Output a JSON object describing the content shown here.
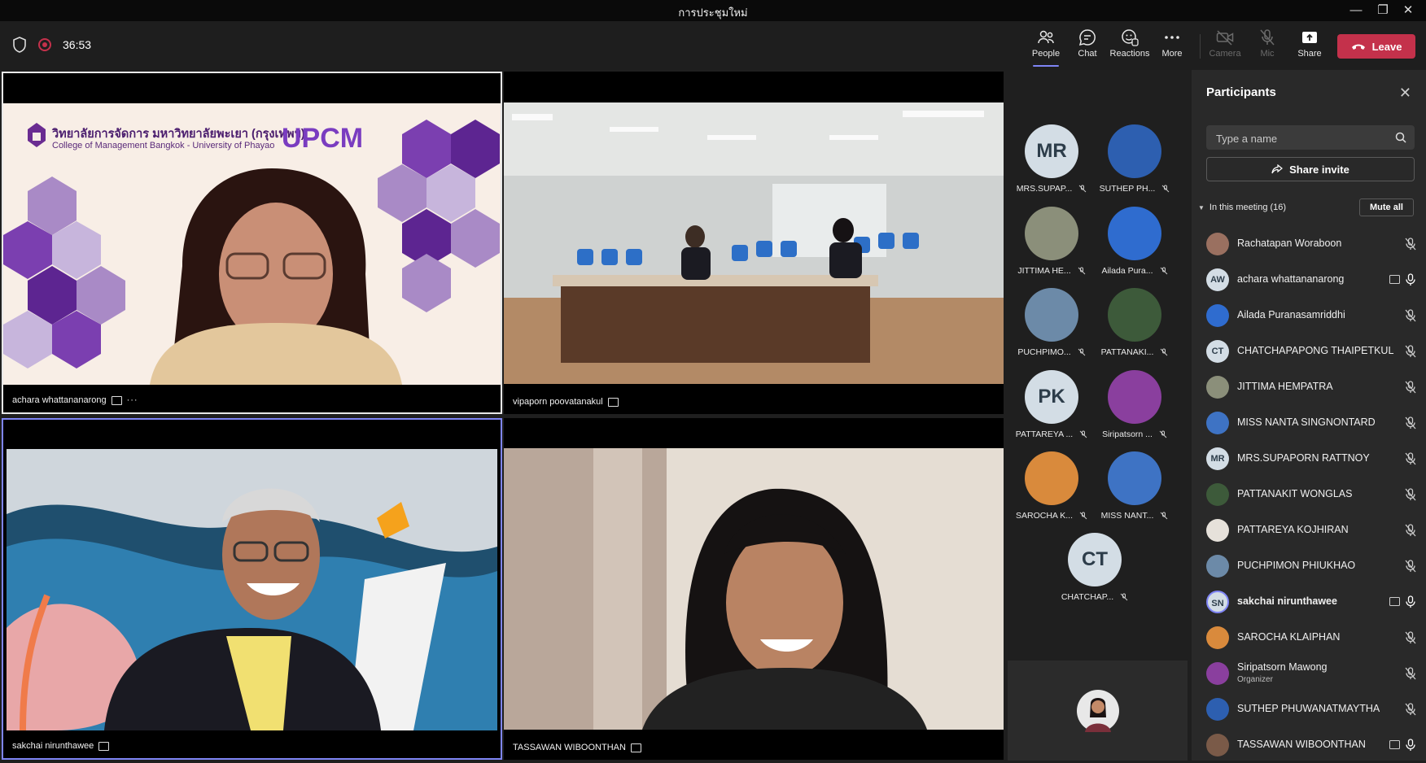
{
  "window": {
    "title": "การประชุมใหม่",
    "minimize": "—",
    "maximize": "❐",
    "close": "✕"
  },
  "toolbar": {
    "timer": "36:53",
    "buttons": {
      "people": "People",
      "chat": "Chat",
      "reactions": "Reactions",
      "more": "More",
      "camera": "Camera",
      "mic": "Mic",
      "share": "Share"
    },
    "leave": "Leave"
  },
  "stage": {
    "tiles": [
      {
        "name": "achara whattananarong",
        "more": "···",
        "slide": {
          "uni_th": "วิทยาลัยการจัดการ มหาวิทยาลัยพะเยา (กรุงเทพฯ)",
          "uni_en": "College of Management Bangkok - University of Phayao",
          "brand": "UPCM"
        }
      },
      {
        "name": "vipaporn poovatanakul"
      },
      {
        "name": "sakchai nirunthawee"
      },
      {
        "name": "TASSAWAN WIBOONTHAN"
      }
    ]
  },
  "gallery": [
    {
      "initials": "MR",
      "label": "MRS.SUPAP..."
    },
    {
      "initials": "",
      "label": "SUTHEP PH..."
    },
    {
      "initials": "",
      "label": "JITTIMA HE..."
    },
    {
      "initials": "",
      "label": "Ailada Pura..."
    },
    {
      "initials": "",
      "label": "PUCHPIMO..."
    },
    {
      "initials": "",
      "label": "PATTANAKI..."
    },
    {
      "initials": "PK",
      "label": "PATTAREYA ..."
    },
    {
      "initials": "",
      "label": "Siripatsorn ..."
    },
    {
      "initials": "",
      "label": "SAROCHA K..."
    },
    {
      "initials": "",
      "label": "MISS NANT..."
    },
    {
      "initials": "CT",
      "label": "CHATCHAP..."
    }
  ],
  "panel": {
    "title": "Participants",
    "search_placeholder": "Type a name",
    "share_invite": "Share invite",
    "section": "In this meeting (16)",
    "mute_all": "Mute all",
    "participants": [
      {
        "initials": "",
        "name": "Rachatapan Woraboon",
        "role": ""
      },
      {
        "initials": "AW",
        "name": "achara whattananarong",
        "role": ""
      },
      {
        "initials": "",
        "name": "Ailada Puranasamriddhi",
        "role": ""
      },
      {
        "initials": "CT",
        "name": "CHATCHAPAPONG THAIPETKUL",
        "role": ""
      },
      {
        "initials": "",
        "name": "JITTIMA HEMPATRA",
        "role": ""
      },
      {
        "initials": "",
        "name": "MISS NANTA SINGNONTARD",
        "role": ""
      },
      {
        "initials": "MR",
        "name": "MRS.SUPAPORN RATTNOY",
        "role": ""
      },
      {
        "initials": "",
        "name": "PATTANAKIT WONGLAS",
        "role": ""
      },
      {
        "initials": "",
        "name": "PATTAREYA KOJHIRAN",
        "role": ""
      },
      {
        "initials": "",
        "name": "PUCHPIMON PHIUKHAO",
        "role": ""
      },
      {
        "initials": "SN",
        "name": "sakchai nirunthawee",
        "role": ""
      },
      {
        "initials": "",
        "name": "SAROCHA KLAIPHAN",
        "role": ""
      },
      {
        "initials": "",
        "name": "Siripatsorn Mawong",
        "role": "Organizer"
      },
      {
        "initials": "",
        "name": "SUTHEP PHUWANATMAYTHA",
        "role": ""
      },
      {
        "initials": "",
        "name": "TASSAWAN WIBOONTHAN",
        "role": ""
      }
    ]
  }
}
